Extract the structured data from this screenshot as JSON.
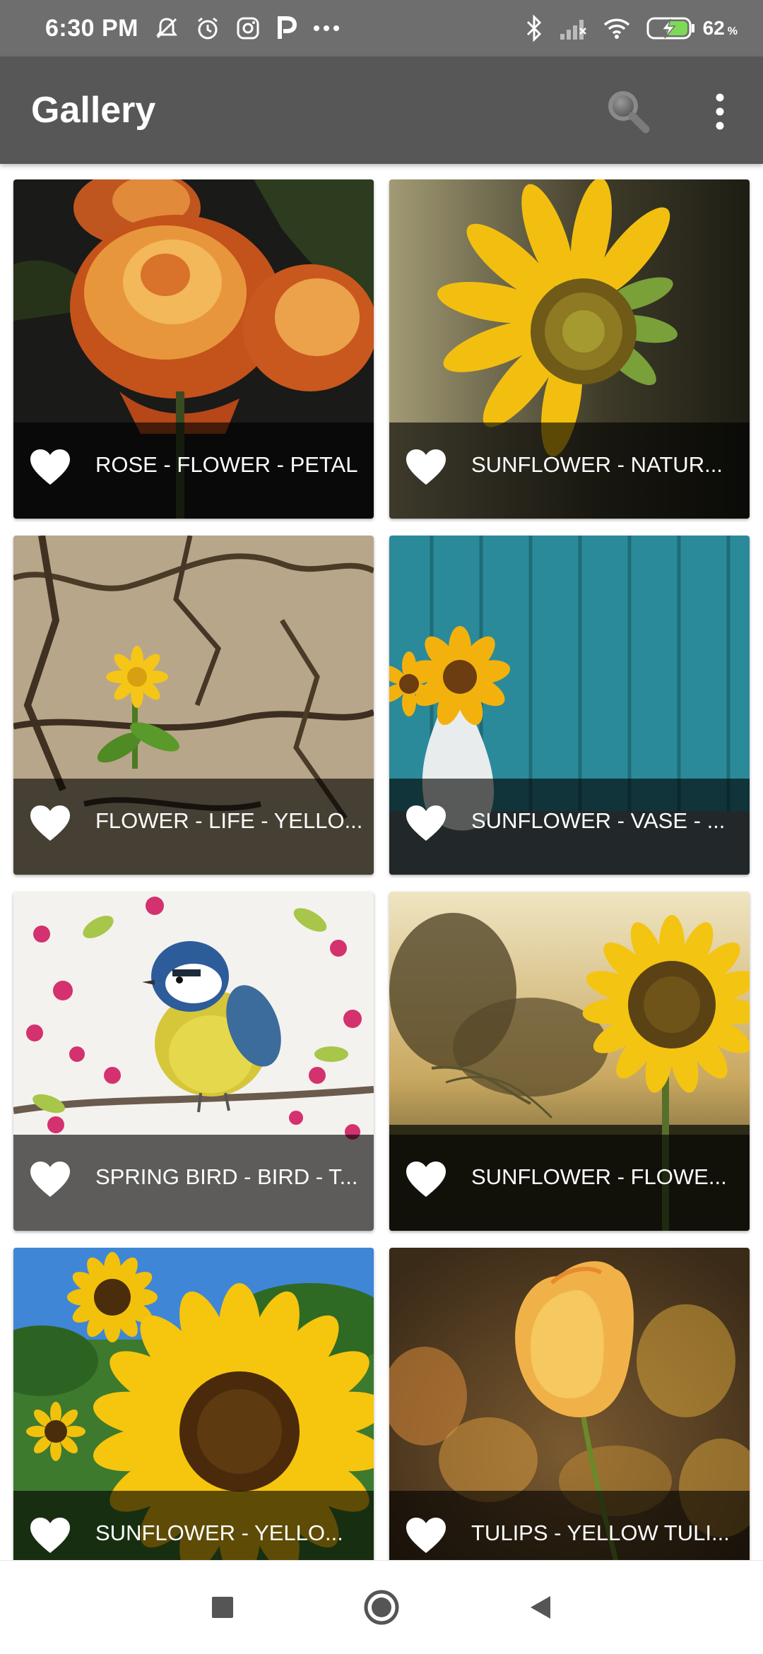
{
  "status_bar": {
    "time": "6:30 PM",
    "battery_level": "62",
    "battery_unit": "%",
    "icons": [
      "mute-icon",
      "alarm-icon",
      "instagram-icon",
      "p-app-icon",
      "more-notifications-icon",
      "bluetooth-icon",
      "signal-icon",
      "wifi-icon",
      "battery-charging-icon"
    ]
  },
  "app_bar": {
    "title": "Gallery",
    "search_icon": "search-icon",
    "menu_icon": "more-vert-icon"
  },
  "gallery": {
    "items": [
      {
        "title": "ROSE - FLOWER - PETAL",
        "favorite_icon": "heart-icon"
      },
      {
        "title": "SUNFLOWER - NATUR...",
        "favorite_icon": "heart-icon"
      },
      {
        "title": "FLOWER - LIFE - YELLO...",
        "favorite_icon": "heart-icon"
      },
      {
        "title": "SUNFLOWER - VASE - ...",
        "favorite_icon": "heart-icon"
      },
      {
        "title": "SPRING BIRD - BIRD - T...",
        "favorite_icon": "heart-icon"
      },
      {
        "title": "SUNFLOWER - FLOWE...",
        "favorite_icon": "heart-icon"
      },
      {
        "title": "SUNFLOWER - YELLO...",
        "favorite_icon": "heart-icon"
      },
      {
        "title": "TULIPS - YELLOW TULI...",
        "favorite_icon": "heart-icon"
      }
    ]
  },
  "nav_bar": {
    "recents_icon": "square-recents-icon",
    "home_icon": "circle-home-icon",
    "back_icon": "triangle-back-icon"
  },
  "colors": {
    "status_bar": "#6e6e6e",
    "app_bar": "#575757",
    "caption_overlay": "#000000",
    "text": "#ffffff"
  }
}
